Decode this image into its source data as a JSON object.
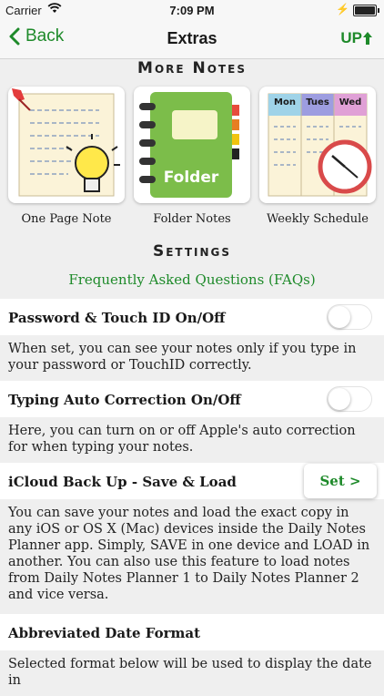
{
  "status": {
    "carrier": "Carrier",
    "time": "7:09 PM"
  },
  "nav": {
    "back_label": "Back",
    "title": "Extras",
    "up_label": "UP"
  },
  "more_notes": {
    "heading": "More Notes",
    "items": [
      {
        "label": "One Page Note"
      },
      {
        "label": "Folder Notes",
        "thumb_text": "Folder"
      },
      {
        "label": "Weekly Schedule",
        "days": [
          "Mon",
          "Tues",
          "Wed"
        ]
      }
    ]
  },
  "settings": {
    "heading": "Settings",
    "faq_label": "Frequently Asked Questions (FAQs)",
    "password": {
      "label": "Password & Touch ID On/Off",
      "desc": "When set, you can see your notes only if you type in your password or TouchID correctly."
    },
    "autocorrect": {
      "label": "Typing Auto Correction On/Off",
      "desc": "Here, you can turn on or off Apple's auto correction for when typing your notes."
    },
    "icloud": {
      "label": "iCloud Back Up - Save & Load",
      "button": "Set >",
      "desc": "You can save your notes and load the exact copy in any iOS or OS X (Mac) devices inside the Daily Notes Planner app. Simply, SAVE in one device and LOAD in another. You can also use this feature to load notes from Daily Notes Planner 1 to Daily Notes Planner 2 and vice versa."
    },
    "date_format": {
      "label": "Abbreviated Date Format",
      "desc": "Selected format below will be used to display the date in"
    }
  },
  "colors": {
    "accent": "#1e8a2a",
    "background": "#efefef"
  }
}
